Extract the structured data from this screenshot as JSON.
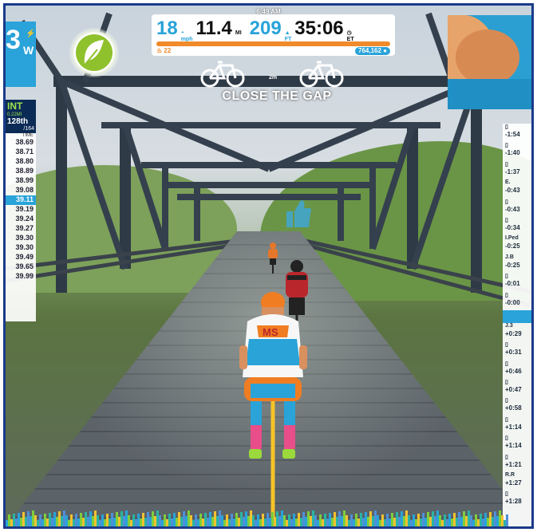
{
  "clock": "6:49 AM",
  "hud": {
    "speed": "18",
    "speed_unit": "mph",
    "distance": "11.4",
    "distance_unit": "MI",
    "elevation": "209",
    "elevation_unit": "FT",
    "time": "35:06",
    "time_unit": "ET",
    "energy": "22",
    "xp": "764,162"
  },
  "power": {
    "value": "3",
    "unit": "W",
    "icon": "bolt-icon"
  },
  "powerup": {
    "icon": "feather-icon",
    "color": "#8fc12d"
  },
  "banner": {
    "distance": "2m",
    "label": "CLOSE THE GAP"
  },
  "sprint": {
    "title": "INT",
    "distance": "0.22MI",
    "position": "128th",
    "total": "/164",
    "header": "TIME",
    "times": [
      "38.69",
      "38.71",
      "38.80",
      "38.89",
      "38.99",
      "39.08",
      "39.11",
      "39.19",
      "39.24",
      "39.27",
      "39.30",
      "39.30",
      "39.49",
      "39.65",
      "39.99"
    ],
    "highlight_index": 6
  },
  "riders_list": [
    {
      "name": "",
      "gap": "-1:54"
    },
    {
      "name": "",
      "gap": "-1:40"
    },
    {
      "name": "",
      "gap": "-1:37"
    },
    {
      "name": "E.",
      "gap": "-0:43"
    },
    {
      "name": "",
      "gap": "-0:43"
    },
    {
      "name": "",
      "gap": "-0:34"
    },
    {
      "name": "I.Ped",
      "gap": "-0:25"
    },
    {
      "name": "J.B",
      "gap": "-0:25"
    },
    {
      "name": "",
      "gap": "-0:01"
    },
    {
      "name": "",
      "gap": "-0:00"
    },
    {
      "name": "",
      "gap": ""
    },
    {
      "name": "J.3",
      "gap": "+0:29"
    },
    {
      "name": "",
      "gap": "+0:31"
    },
    {
      "name": "",
      "gap": "+0:46"
    },
    {
      "name": "",
      "gap": "+0:47"
    },
    {
      "name": "",
      "gap": "+0:58"
    },
    {
      "name": "",
      "gap": "+1:14"
    },
    {
      "name": "",
      "gap": "+1:14"
    },
    {
      "name": "",
      "gap": "+1:21"
    },
    {
      "name": "R.R",
      "gap": "+1:27"
    },
    {
      "name": "",
      "gap": "+1:28"
    }
  ],
  "highlight_row": 10,
  "colors": {
    "accent": "#29a3d9",
    "orange": "#f08a2a",
    "navy": "#0b2a55"
  }
}
